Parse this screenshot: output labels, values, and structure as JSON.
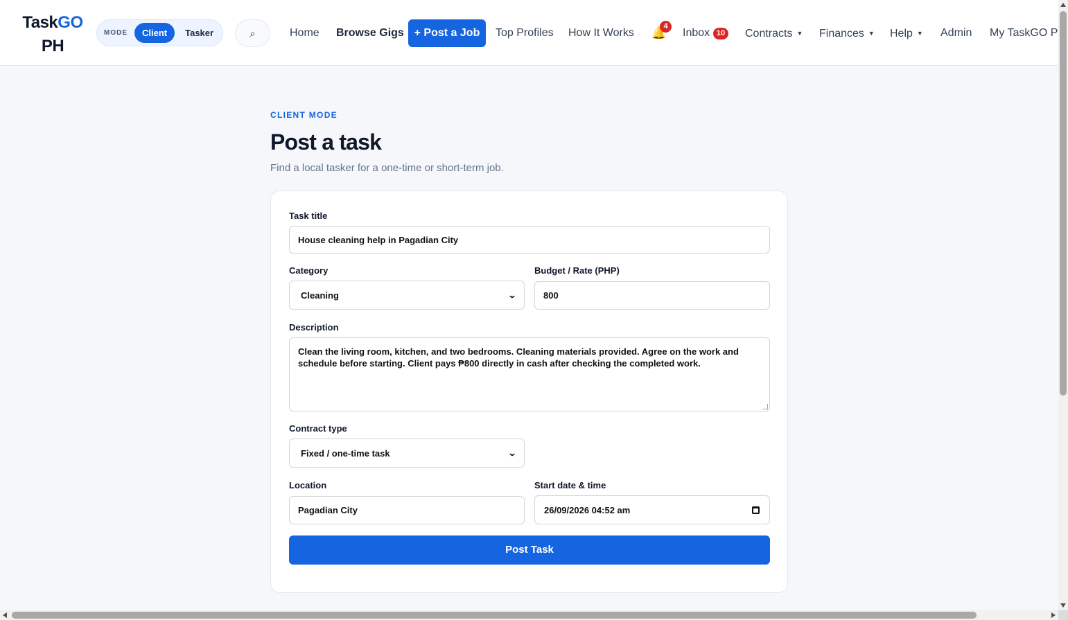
{
  "brand": {
    "name_part1": "Task",
    "name_part2": "GO",
    "name_line2": "PH",
    "accent_color": "#1565e0"
  },
  "mode_toggle": {
    "label": "MODE",
    "options": [
      "Client",
      "Tasker"
    ],
    "selected": "Client"
  },
  "search": {
    "icon": "search-icon",
    "glyph": "⌕"
  },
  "nav": {
    "home": "Home",
    "browse_gigs": "Browse Gigs",
    "post_job": "+ Post a Job",
    "top_profiles": "Top Profiles",
    "how_it_works": "How It Works",
    "notifications_count": "4",
    "inbox": "Inbox",
    "inbox_count": "10",
    "contracts": "Contracts",
    "finances": "Finances",
    "help": "Help",
    "admin": "Admin",
    "account": "My TaskGO PH"
  },
  "page": {
    "eyebrow": "CLIENT MODE",
    "title": "Post a task",
    "subtitle": "Find a local tasker for a one-time or short-term job."
  },
  "form": {
    "task_title": {
      "label": "Task title",
      "value": "House cleaning help in Pagadian City"
    },
    "category": {
      "label": "Category",
      "value": "Cleaning"
    },
    "budget": {
      "label": "Budget / Rate (PHP)",
      "value": "800"
    },
    "description": {
      "label": "Description",
      "value": "Clean the living room, kitchen, and two bedrooms. Cleaning materials provided. Agree on the work and schedule before starting. Client pays ₱800 directly in cash after checking the completed work."
    },
    "contract_type": {
      "label": "Contract type",
      "value": "Fixed / one-time task"
    },
    "location": {
      "label": "Location",
      "value": "Pagadian City"
    },
    "start": {
      "label": "Start date & time",
      "value": "26/09/2026 04:52 am"
    },
    "submit_label": "Post Task"
  }
}
